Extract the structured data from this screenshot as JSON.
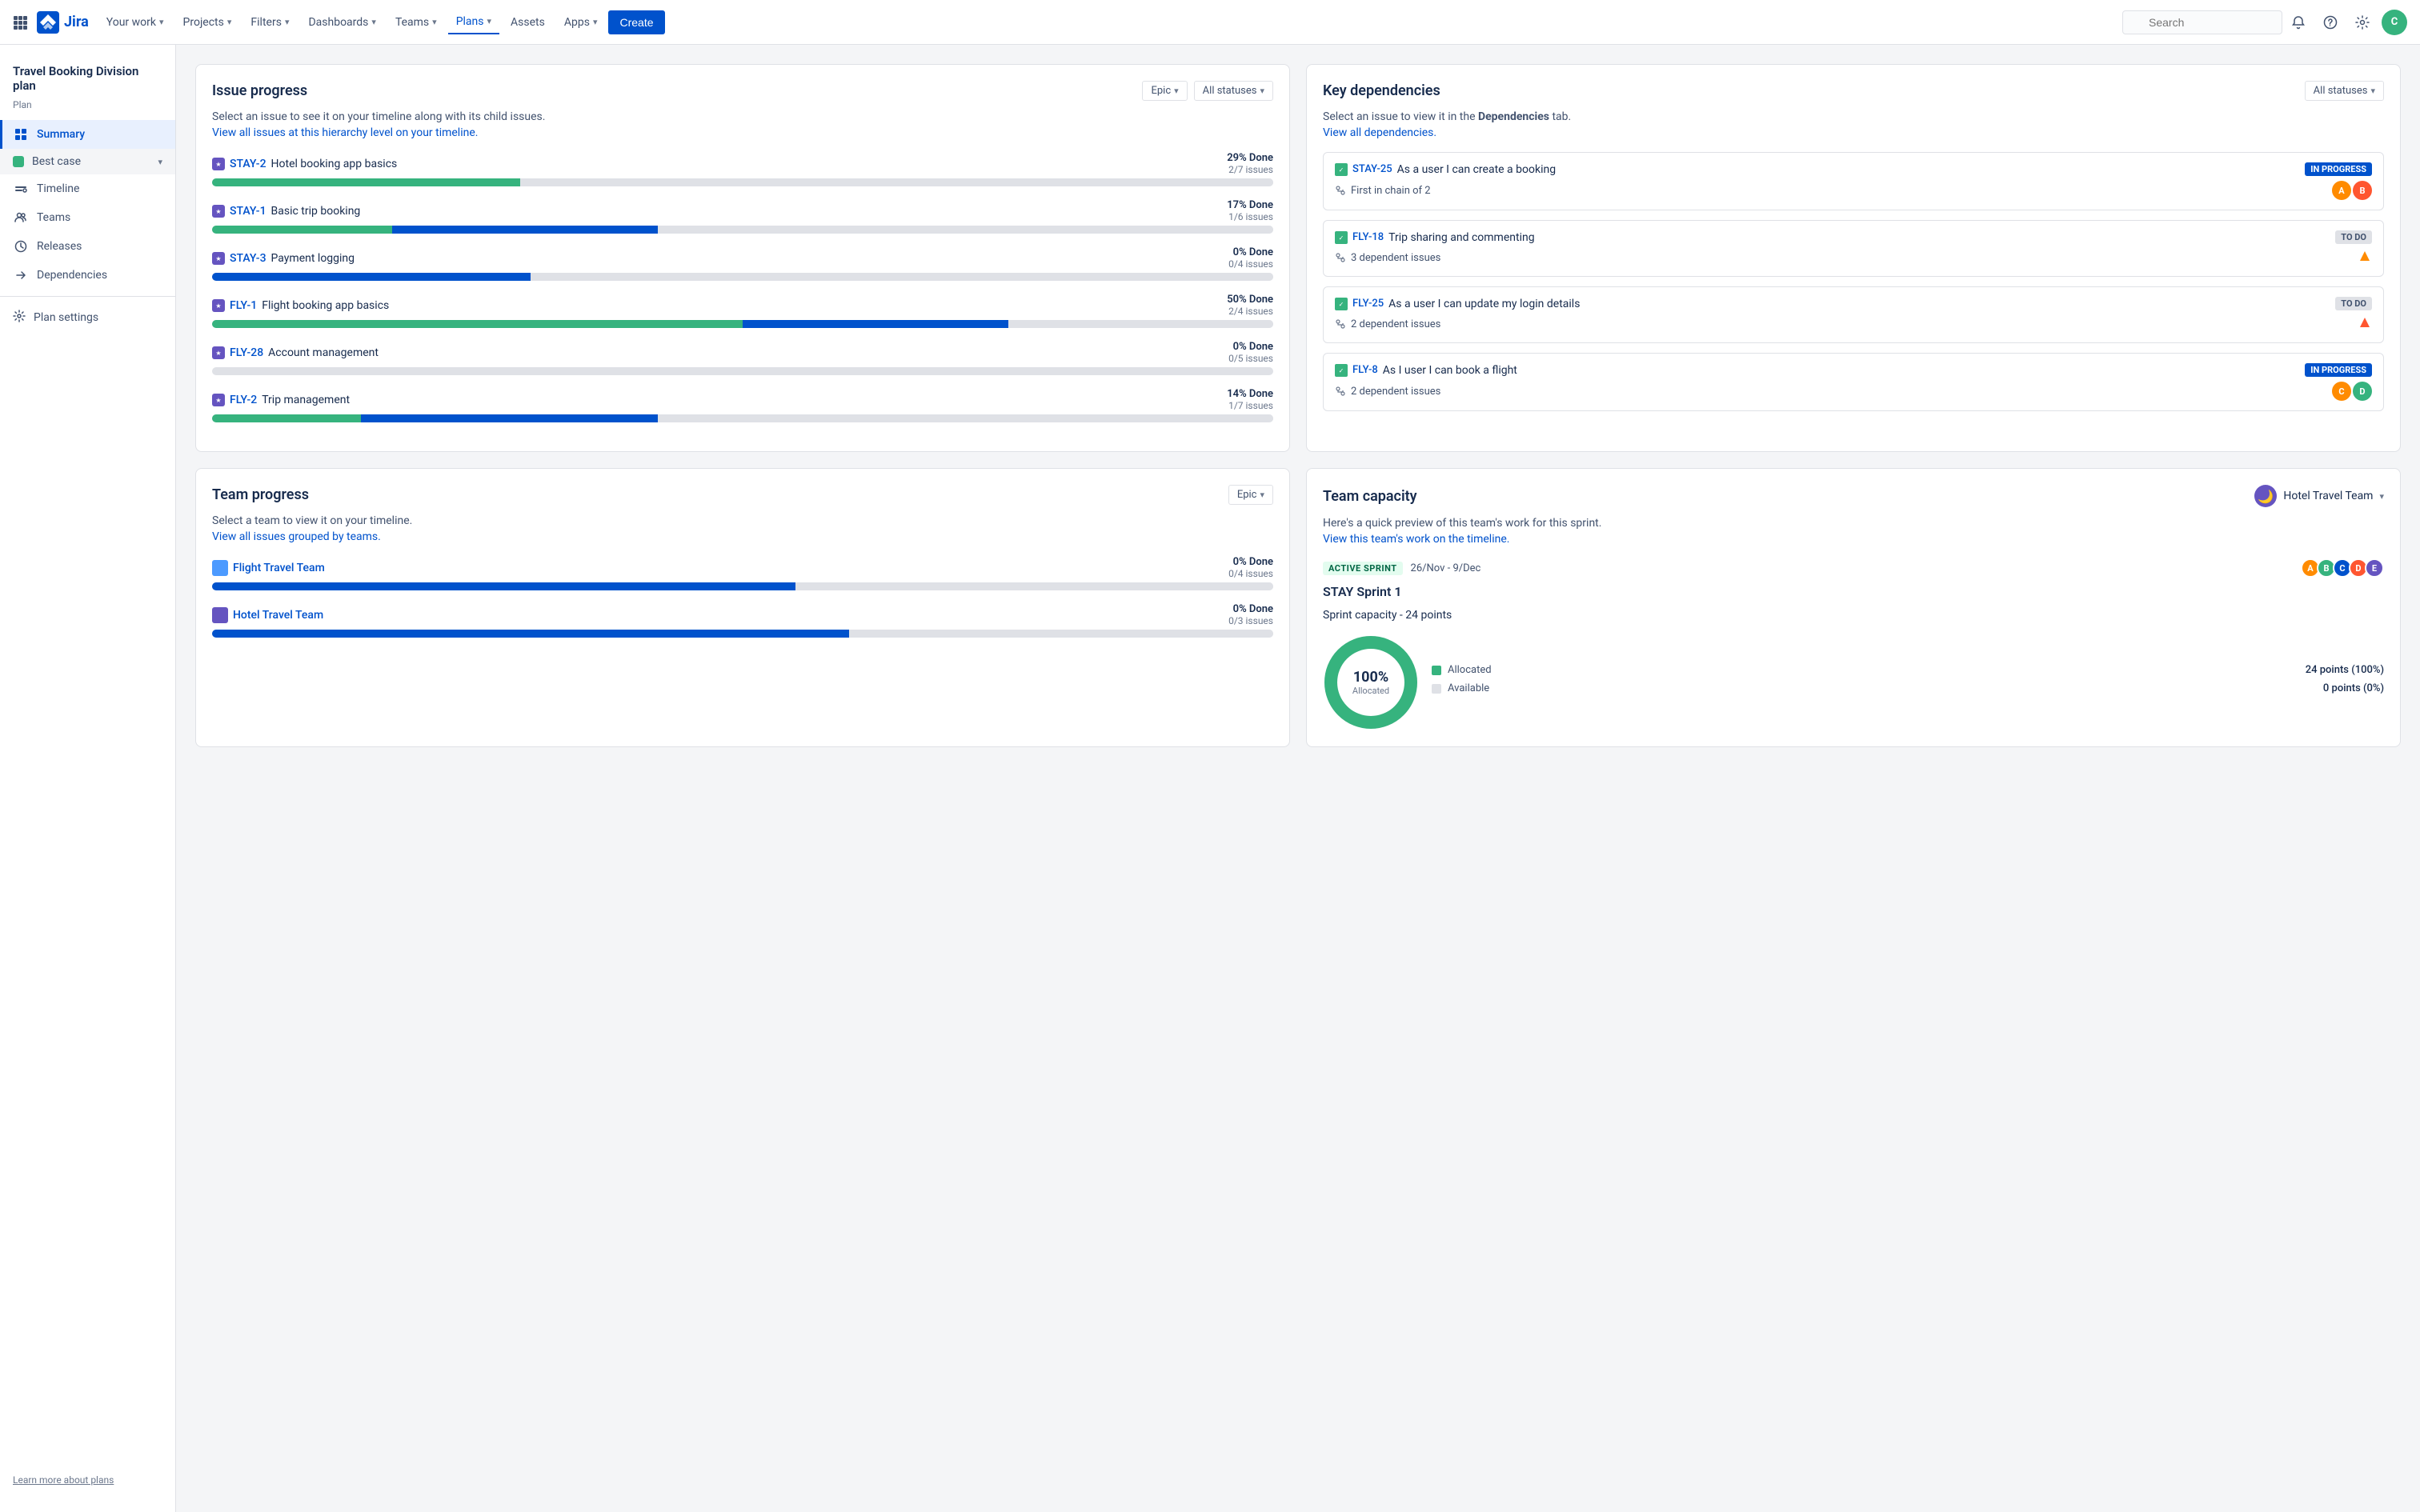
{
  "topnav": {
    "logo_text": "Jira",
    "your_work": "Your work",
    "projects": "Projects",
    "filters": "Filters",
    "dashboards": "Dashboards",
    "teams": "Teams",
    "plans": "Plans",
    "assets": "Assets",
    "apps": "Apps",
    "create": "Create",
    "search_placeholder": "Search",
    "avatar_initials": "C"
  },
  "sidebar": {
    "plan_name": "Travel Booking Division plan",
    "plan_label": "Plan",
    "summary_label": "Summary",
    "best_case_label": "Best case",
    "timeline_label": "Timeline",
    "teams_label": "Teams",
    "releases_label": "Releases",
    "dependencies_label": "Dependencies",
    "plan_settings_label": "Plan settings",
    "footer_link": "Learn more about plans"
  },
  "issue_progress": {
    "title": "Issue progress",
    "filter1": "Epic",
    "filter2": "All statuses",
    "subtitle": "Select an issue to see it on your timeline along with its child issues.",
    "link": "View all issues at this hierarchy level on your timeline.",
    "issues": [
      {
        "key": "STAY-2",
        "title": "Hotel booking app basics",
        "done_pct": "29% Done",
        "issues": "2/7 issues",
        "green": 29,
        "blue": 0,
        "gray": 71
      },
      {
        "key": "STAY-1",
        "title": "Basic trip booking",
        "done_pct": "17% Done",
        "issues": "1/6 issues",
        "green": 17,
        "blue": 25,
        "gray": 58
      },
      {
        "key": "STAY-3",
        "title": "Payment logging",
        "done_pct": "0% Done",
        "issues": "0/4 issues",
        "green": 0,
        "blue": 30,
        "gray": 70
      },
      {
        "key": "FLY-1",
        "title": "Flight booking app basics",
        "done_pct": "50% Done",
        "issues": "2/4 issues",
        "green": 50,
        "blue": 25,
        "gray": 25
      },
      {
        "key": "FLY-28",
        "title": "Account management",
        "done_pct": "0% Done",
        "issues": "0/5 issues",
        "green": 0,
        "blue": 0,
        "gray": 100
      },
      {
        "key": "FLY-2",
        "title": "Trip management",
        "done_pct": "14% Done",
        "issues": "1/7 issues",
        "green": 14,
        "blue": 28,
        "gray": 58
      }
    ]
  },
  "key_dependencies": {
    "title": "Key dependencies",
    "filter": "All statuses",
    "subtitle1": "Select an issue to view it in the",
    "subtitle_bold": "Dependencies",
    "subtitle2": "tab.",
    "link": "View all dependencies.",
    "items": [
      {
        "key": "STAY-25",
        "title": "As a user I can create a booking",
        "badge": "IN PROGRESS",
        "badge_type": "in-progress",
        "sub_text": "First in chain of 2",
        "sub_icon": "chain",
        "avatar1_color": "#FF8B00",
        "avatar1_initial": "A",
        "avatar2_color": "#FF5630",
        "avatar2_initial": "B"
      },
      {
        "key": "FLY-18",
        "title": "Trip sharing and commenting",
        "badge": "TO DO",
        "badge_type": "to-do",
        "sub_text": "3 dependent issues",
        "sub_icon": "deps",
        "priority_color": "#FF8B00"
      },
      {
        "key": "FLY-25",
        "title": "As a user I can update my login details",
        "badge": "TO DO",
        "badge_type": "to-do",
        "sub_text": "2 dependent issues",
        "sub_icon": "deps",
        "priority_color": "#FF5630"
      },
      {
        "key": "FLY-8",
        "title": "As I user I can book a flight",
        "badge": "IN PROGRESS",
        "badge_type": "in-progress",
        "sub_text": "2 dependent issues",
        "sub_icon": "deps",
        "avatar1_color": "#FF8B00",
        "avatar1_initial": "C",
        "avatar2_color": "#36B37E",
        "avatar2_initial": "D"
      }
    ]
  },
  "team_progress": {
    "title": "Team progress",
    "filter": "Epic",
    "subtitle": "Select a team to view it on your timeline.",
    "link": "View all issues grouped by teams.",
    "teams": [
      {
        "name": "Flight Travel Team",
        "done_pct": "0% Done",
        "issues": "0/4 issues",
        "blue": 55,
        "gray": 45,
        "icon_type": "blue"
      },
      {
        "name": "Hotel Travel Team",
        "done_pct": "0% Done",
        "issues": "0/3 issues",
        "blue": 60,
        "gray": 40,
        "icon_type": "purple"
      }
    ]
  },
  "team_capacity": {
    "title": "Team capacity",
    "team_name": "Hotel Travel Team",
    "subtitle": "Here's a quick preview of this team's work for this sprint.",
    "link": "View this team's work on the timeline.",
    "sprint_badge": "ACTIVE SPRINT",
    "sprint_dates": "26/Nov - 9/Dec",
    "sprint_name": "STAY Sprint 1",
    "sprint_capacity_label": "Sprint capacity - 24 points",
    "donut_pct": "100%",
    "donut_label": "Allocated",
    "legend": [
      {
        "label": "Allocated",
        "value": "24 points (100%)",
        "color": "#36b37e"
      },
      {
        "label": "Available",
        "value": "0 points (0%)",
        "color": "#dfe1e6"
      }
    ],
    "avatars": [
      {
        "color": "#FF8B00",
        "initial": "A"
      },
      {
        "color": "#36B37E",
        "initial": "B"
      },
      {
        "color": "#0052cc",
        "initial": "C"
      },
      {
        "color": "#FF5630",
        "initial": "D"
      },
      {
        "color": "#6554c0",
        "initial": "E"
      }
    ]
  }
}
